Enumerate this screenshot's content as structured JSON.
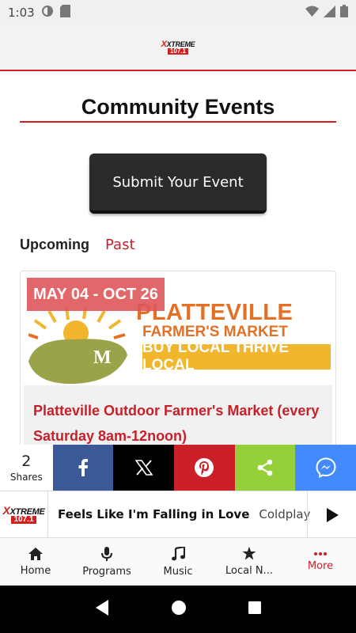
{
  "status_bar": {
    "time": "1:03",
    "icons": [
      "notification-icon",
      "sd-card-icon",
      "wifi-icon",
      "signal-icon",
      "battery-icon"
    ]
  },
  "app_header": {
    "logo_line1": "XTREME",
    "logo_line2": "107.1"
  },
  "page": {
    "title": "Community Events",
    "submit_button": "Submit Your Event",
    "tabs": [
      {
        "label": "Upcoming",
        "active": true
      },
      {
        "label": "Past",
        "active": false
      }
    ]
  },
  "events": [
    {
      "date_badge": "MAY 04 - OCT 26",
      "image_title_line1": "PLATTEVILLE",
      "image_title_line2": "FARMER'S MARKET",
      "image_banner": "BUY LOCAL THRIVE LOCAL",
      "image_monogram": "M",
      "name": "Platteville Outdoor Farmer's Market (every Saturday 8am-12noon)"
    }
  ],
  "share_bar": {
    "count": "2",
    "count_label": "Shares",
    "buttons": [
      "facebook-icon",
      "x-icon",
      "pinterest-icon",
      "share-icon",
      "messenger-icon"
    ],
    "colors": {
      "facebook": "#3b5998",
      "x": "#000000",
      "pinterest": "#cb2027",
      "share": "#95d03a",
      "messenger": "#448aff"
    }
  },
  "now_playing": {
    "song": "Feels Like I'm Falling in Love",
    "artist": "Coldplay"
  },
  "bottom_nav": [
    {
      "label": "Home",
      "icon": "home-icon",
      "active": false
    },
    {
      "label": "Programs",
      "icon": "microphone-icon",
      "active": false
    },
    {
      "label": "Music",
      "icon": "music-note-icon",
      "active": false
    },
    {
      "label": "Local N...",
      "icon": "star-icon",
      "active": false
    },
    {
      "label": "More",
      "icon": "more-dots-icon",
      "active": true
    }
  ],
  "accent_color": "#c8202a"
}
